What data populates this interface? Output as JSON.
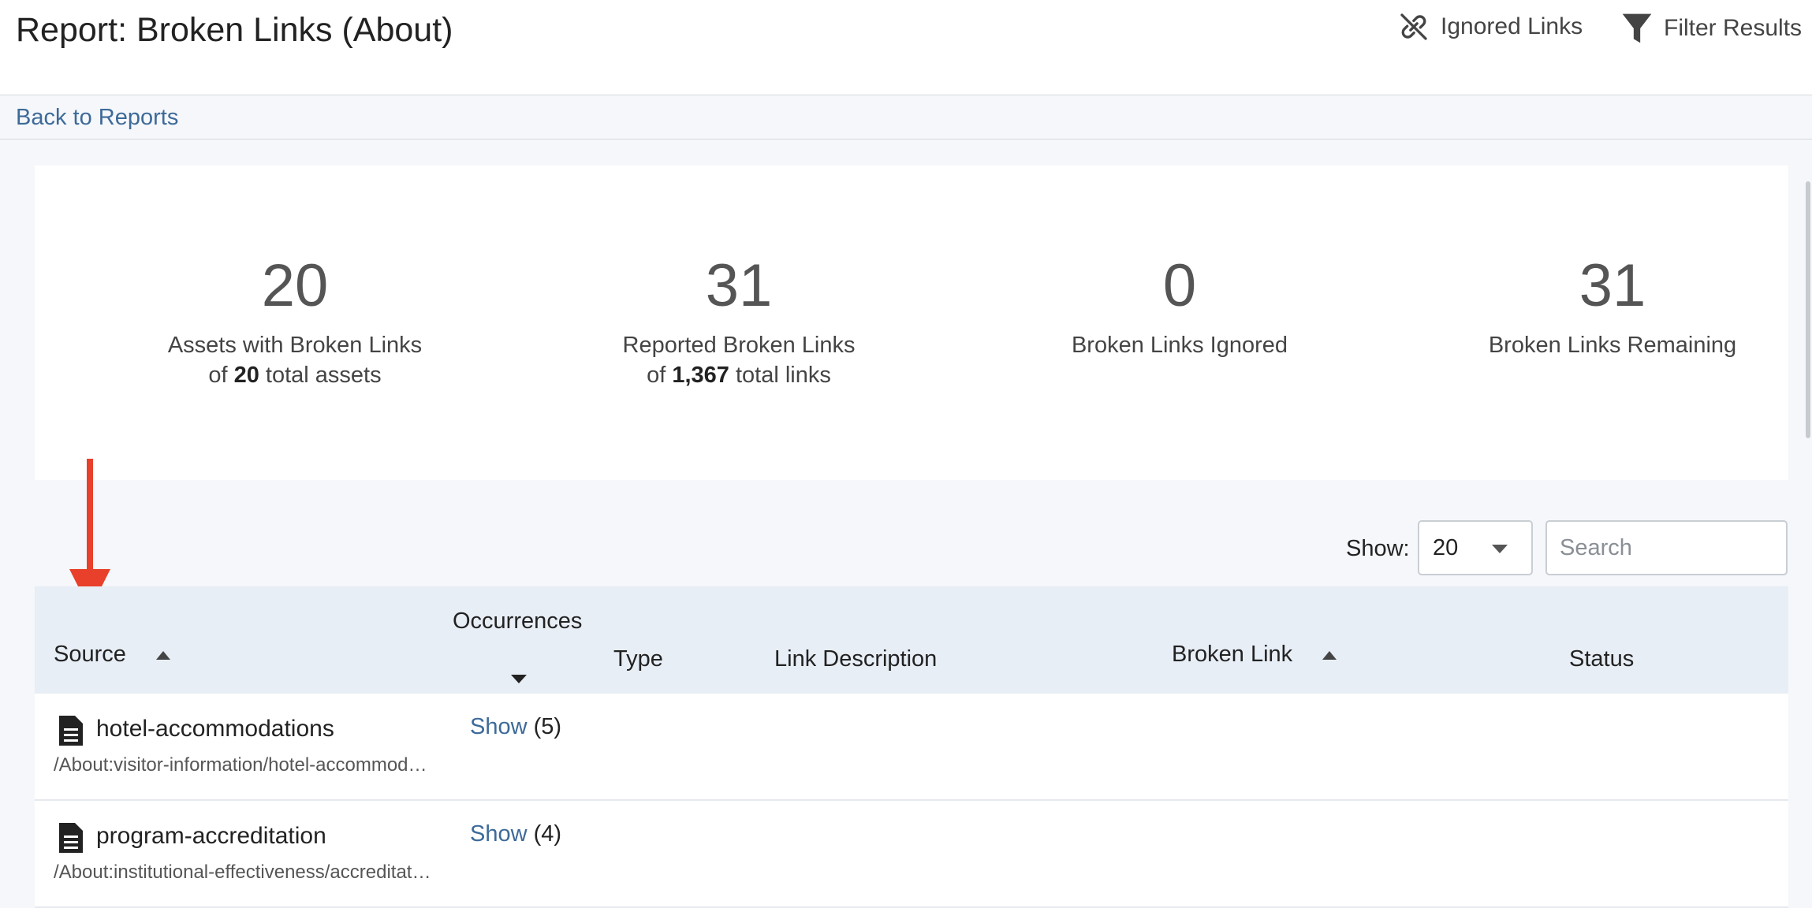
{
  "header": {
    "title": "Report: Broken Links (About)",
    "ignored_links_label": "Ignored Links",
    "filter_results_label": "Filter Results"
  },
  "nav": {
    "back_label": "Back to Reports"
  },
  "stats": [
    {
      "value": "20",
      "label": "Assets with Broken Links",
      "sub_prefix": "of ",
      "sub_bold": "20",
      "sub_suffix": " total assets"
    },
    {
      "value": "31",
      "label": "Reported Broken Links",
      "sub_prefix": "of ",
      "sub_bold": "1,367",
      "sub_suffix": " total links"
    },
    {
      "value": "0",
      "label": "Broken Links Ignored"
    },
    {
      "value": "31",
      "label": "Broken Links Remaining"
    }
  ],
  "controls": {
    "show_label": "Show:",
    "page_size": "20",
    "search_placeholder": "Search"
  },
  "table": {
    "columns": {
      "source": "Source",
      "occurrences": "Occurrences",
      "type": "Type",
      "link_description": "Link Description",
      "broken_link": "Broken Link",
      "status": "Status"
    },
    "rows": [
      {
        "name": "hotel-accommodations",
        "path": "/About:visitor-information/hotel-accommodations",
        "show_label": "Show",
        "count": "(5)"
      },
      {
        "name": "program-accreditation",
        "path": "/About:institutional-effectiveness/accreditation",
        "show_label": "Show",
        "count": "(4)"
      }
    ]
  },
  "colors": {
    "link": "#3d6a99",
    "header_bg": "#e8eef6",
    "arrow": "#e8402a"
  }
}
